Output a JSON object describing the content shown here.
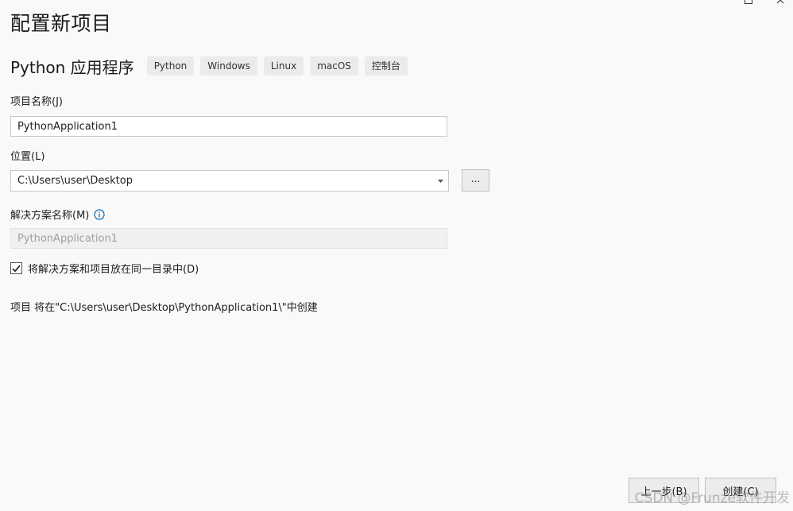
{
  "page": {
    "title": "配置新项目"
  },
  "template": {
    "name": "Python 应用程序",
    "tags": [
      "Python",
      "Windows",
      "Linux",
      "macOS",
      "控制台"
    ]
  },
  "project_name": {
    "label": "项目名称(J)",
    "value": "PythonApplication1"
  },
  "location": {
    "label": "位置(L)",
    "value": "C:\\Users\\user\\Desktop",
    "browse_label": "..."
  },
  "solution_name": {
    "label": "解决方案名称(M)",
    "value": "PythonApplication1",
    "info_icon": "info-icon"
  },
  "same_directory": {
    "label": "将解决方案和项目放在同一目录中(D)",
    "checked": true
  },
  "create_path_text": "项目 将在\"C:\\Users\\user\\Desktop\\PythonApplication1\\\"中创建",
  "footer": {
    "back_label": "上一步(B)",
    "create_label": "创建(C)"
  },
  "watermark": "CSDN @Frunze软件开发",
  "colors": {
    "background": "#f9f9f9",
    "info_icon": "#1f6fb5"
  }
}
